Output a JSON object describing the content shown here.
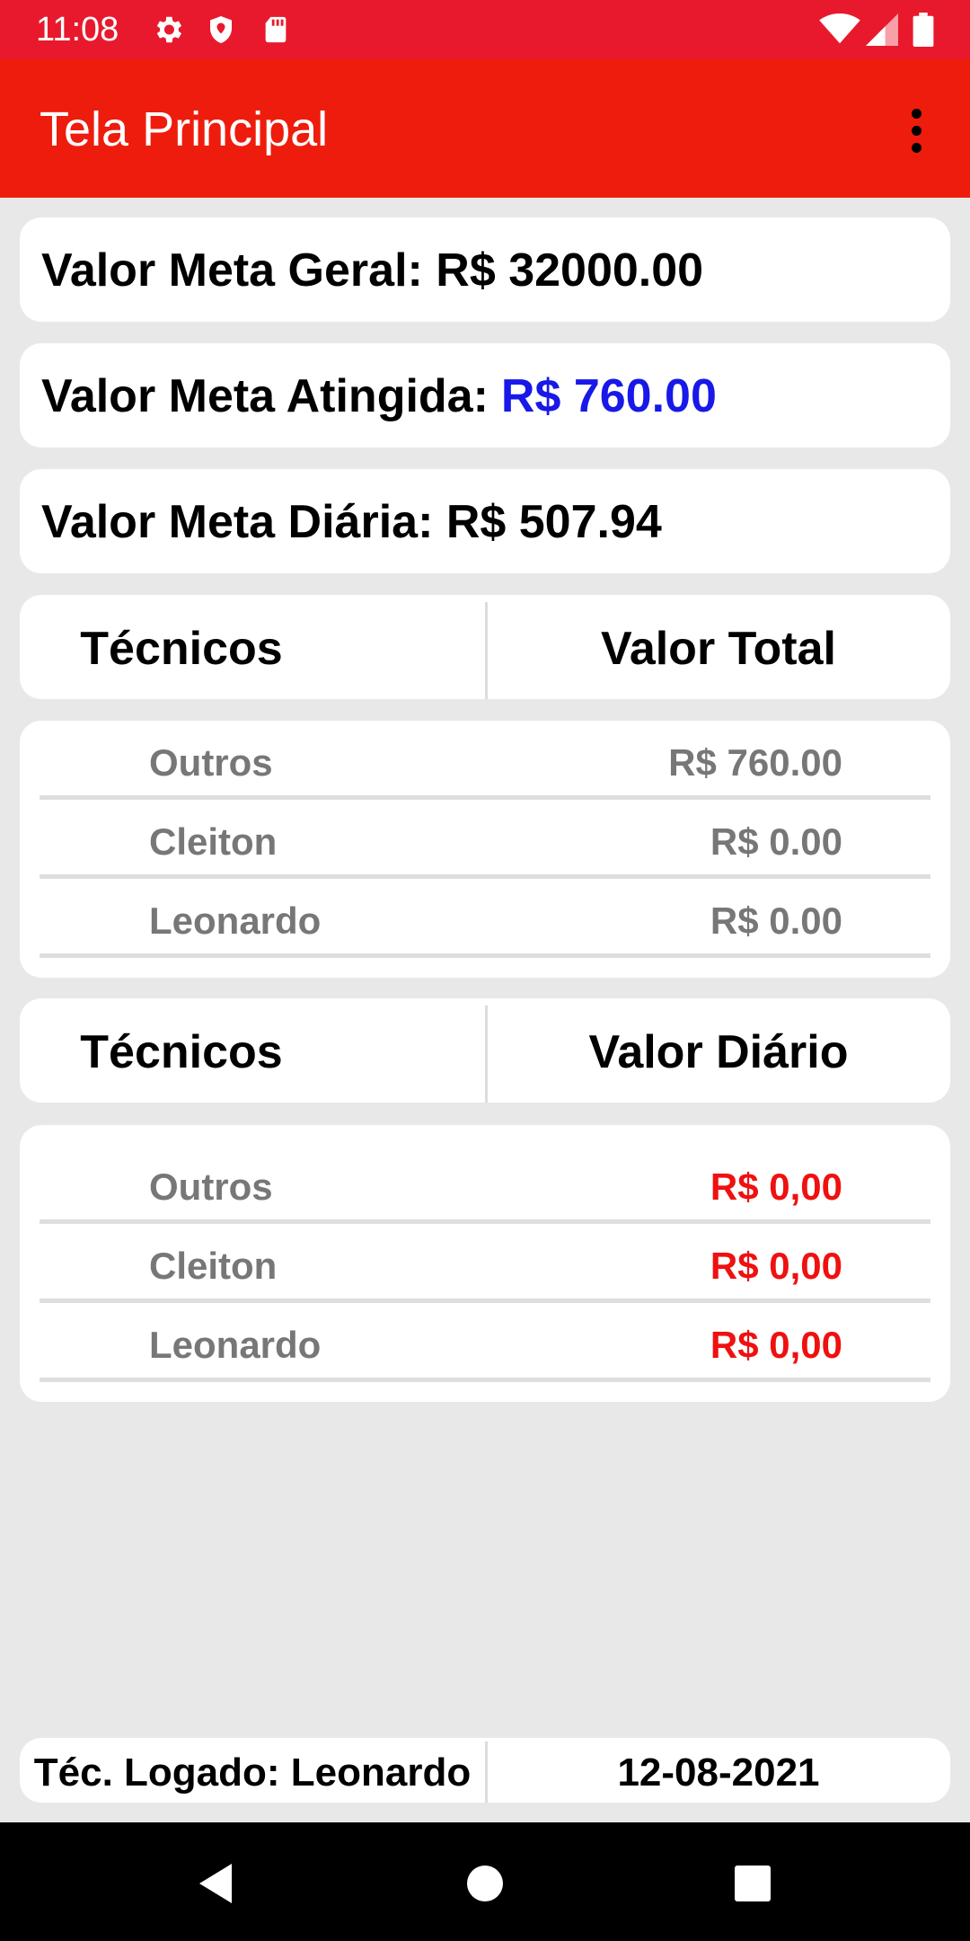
{
  "status_bar": {
    "time": "11:08",
    "left_icons": [
      "settings-gear-icon",
      "shield-icon",
      "sd-card-icon"
    ],
    "right_icons": [
      "wifi-icon",
      "cellular-signal-icon",
      "battery-icon"
    ]
  },
  "app_bar": {
    "title": "Tela Principal",
    "menu_icon": "more-vert-icon"
  },
  "metas": {
    "geral": "Valor Meta Geral: R$ 32000.00",
    "atingida_label": "Valor Meta Atingida:",
    "atingida_value": "R$ 760.00",
    "atingida_color": "#1818e8",
    "diaria": "Valor Meta Diária: R$ 507.94"
  },
  "total_table": {
    "col_left": "Técnicos",
    "col_right": "Valor Total",
    "rows": [
      {
        "name": "Outros",
        "value": "R$ 760.00"
      },
      {
        "name": "Cleiton",
        "value": "R$ 0.00"
      },
      {
        "name": "Leonardo",
        "value": "R$ 0.00"
      }
    ]
  },
  "daily_table": {
    "col_left": "Técnicos",
    "col_right": "Valor Diário",
    "value_color": "#f01010",
    "rows": [
      {
        "name": "Outros",
        "value": "R$ 0,00"
      },
      {
        "name": "Cleiton",
        "value": "R$ 0,00"
      },
      {
        "name": "Leonardo",
        "value": "R$ 0,00"
      }
    ]
  },
  "footer": {
    "logged_tech": "Téc. Logado: Leonardo",
    "date": "12-08-2021"
  },
  "nav_bar": {
    "buttons": [
      "back-triangle-icon",
      "home-circle-icon",
      "recents-square-icon"
    ]
  },
  "colors": {
    "status_bar": "#e8192c",
    "app_bar": "#ee1c0c",
    "background": "#e8e8e8"
  }
}
